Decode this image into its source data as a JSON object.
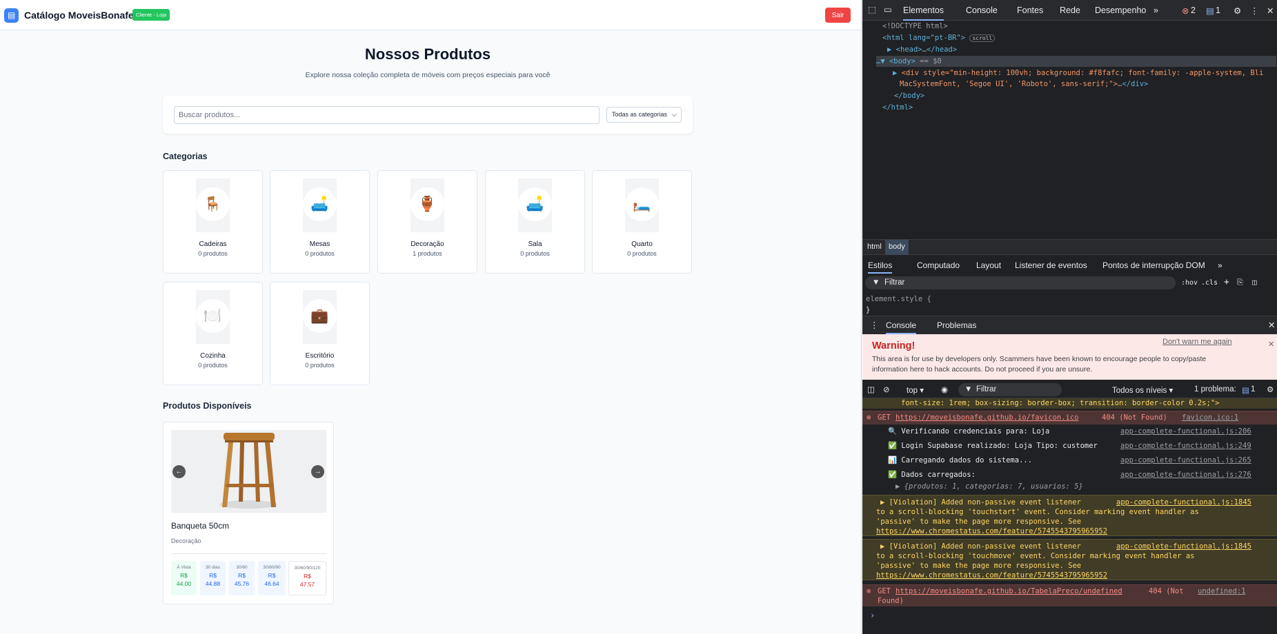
{
  "app": {
    "brand": "Catálogo MoveisBonafe",
    "badge": "Cliente - Loja",
    "logout": "Sair",
    "title": "Nossos Produtos",
    "subtitle": "Explore nossa coleção completa de móveis com preços especiais para você",
    "search_placeholder": "Buscar produtos...",
    "category_select": "Todas as categorias",
    "categories_heading": "Categorias",
    "categories": [
      {
        "name": "Cadeiras",
        "count": "0 produtos",
        "icon": "🪑"
      },
      {
        "name": "Mesas",
        "count": "0 produtos",
        "icon": "🛋️"
      },
      {
        "name": "Decoração",
        "count": "1 produtos",
        "icon": "🏺"
      },
      {
        "name": "Sala",
        "count": "0 produtos",
        "icon": "🛋️"
      },
      {
        "name": "Quarto",
        "count": "0 produtos",
        "icon": "🛏️"
      },
      {
        "name": "Cozinha",
        "count": "0 produtos",
        "icon": "🍽️"
      },
      {
        "name": "Escritório",
        "count": "0 produtos",
        "icon": "💼"
      }
    ],
    "products_heading": "Produtos Disponíveis",
    "product": {
      "name": "Banqueta 50cm",
      "category": "Decoração",
      "prices": [
        {
          "label": "À Vista",
          "currency": "R$",
          "value": "44.00",
          "color": "#16a34a"
        },
        {
          "label": "30 dias",
          "currency": "R$",
          "value": "44.88",
          "color": "#2563eb"
        },
        {
          "label": "30/60",
          "currency": "R$",
          "value": "45.76",
          "color": "#2563eb"
        },
        {
          "label": "30/60/90",
          "currency": "R$",
          "value": "46.64",
          "color": "#2563eb"
        },
        {
          "label": "30/60/90/120",
          "currency": "R$",
          "value": "47.57",
          "color": "#dc2626"
        }
      ]
    }
  },
  "devtools": {
    "tabs": [
      "Elementos",
      "Console",
      "Fontes",
      "Rede",
      "Desempenho"
    ],
    "error_count": "2",
    "issue_count": "1",
    "dom": {
      "doctype": "<!DOCTYPE html>",
      "html_open": "<html lang=\"pt-BR\">",
      "scroll_badge": "scroll",
      "head": "<head>",
      "head_close": "</head>",
      "body": "<body>",
      "body_eq": "== $0",
      "div_line1": "<div style=\"min-height: 100vh; background: #f8fafc; font-family: -apple-system, Bli",
      "div_line2": "MacSystemFont, 'Segoe UI', 'Roboto', sans-serif;\">",
      "div_close": "</div>",
      "body_close": "</body>",
      "html_close": "</html>"
    },
    "breadcrumb": [
      "html",
      "body"
    ],
    "style_tabs": [
      "Estilos",
      "Computado",
      "Layout",
      "Listener de eventos",
      "Pontos de interrupção DOM"
    ],
    "filter": "Filtrar",
    "hov": ":hov",
    "cls": ".cls",
    "element_style": "element.style {",
    "element_style_close": "}",
    "drawer_tabs": [
      "Console",
      "Problemas"
    ],
    "warning": {
      "title": "Warning!",
      "dont_warn": "Don't warn me again",
      "text1": "This area is for use by developers only. Scammers have been known to encourage people to copy/paste",
      "text2": "information here to hack accounts. Do not proceed if you are unsure."
    },
    "console_toolbar": {
      "context": "top",
      "filter": "Filtrar",
      "levels": "Todos os níveis",
      "problems": "1 problema:",
      "problems_count": "1"
    },
    "logs": {
      "prev": "font-size: 1rem; box-sizing: border-box; transition: border-color 0.2s;\">",
      "err1_get": "GET",
      "err1_url": "https://moveisbonafe.github.io/favicon.ico",
      "err1_status": "404 (Not Found)",
      "err1_src": "favicon.ico:1",
      "l1": "🔍 Verificando credenciais para: Loja",
      "l1_src": "app-complete-functional.js:206",
      "l2": "✅ Login Supabase realizado: Loja Tipo: customer",
      "l2_src": "app-complete-functional.js:249",
      "l3": "📊 Carregando dados do sistema...",
      "l3_src": "app-complete-functional.js:265",
      "l4": "✅ Dados carregados:",
      "l4_src": "app-complete-functional.js:276",
      "l5": "▶ {produtos: 1, categorias: 7, usuarios: 5}",
      "v1a": "▶ [Violation] Added non-passive event listener",
      "v1_src": "app-complete-functional.js:1845",
      "v1b": "to a scroll-blocking 'touchstart' event. Consider marking event handler as",
      "v1c": "'passive' to make the page more responsive. See",
      "v1d": "https://www.chromestatus.com/feature/5745543795965952",
      "v2a": "▶ [Violation] Added non-passive event listener",
      "v2_src": "app-complete-functional.js:1845",
      "v2b": "to a scroll-blocking 'touchmove' event. Consider marking event handler as",
      "v2c": "'passive' to make the page more responsive. See",
      "v2d": "https://www.chromestatus.com/feature/5745543795965952",
      "err2_get": "GET",
      "err2_url": "https://moveisbonafe.github.io/TabelaPreco/undefined",
      "err2_status": "404 (Not",
      "err2_status2": "Found)",
      "err2_src": "undefined:1"
    }
  }
}
